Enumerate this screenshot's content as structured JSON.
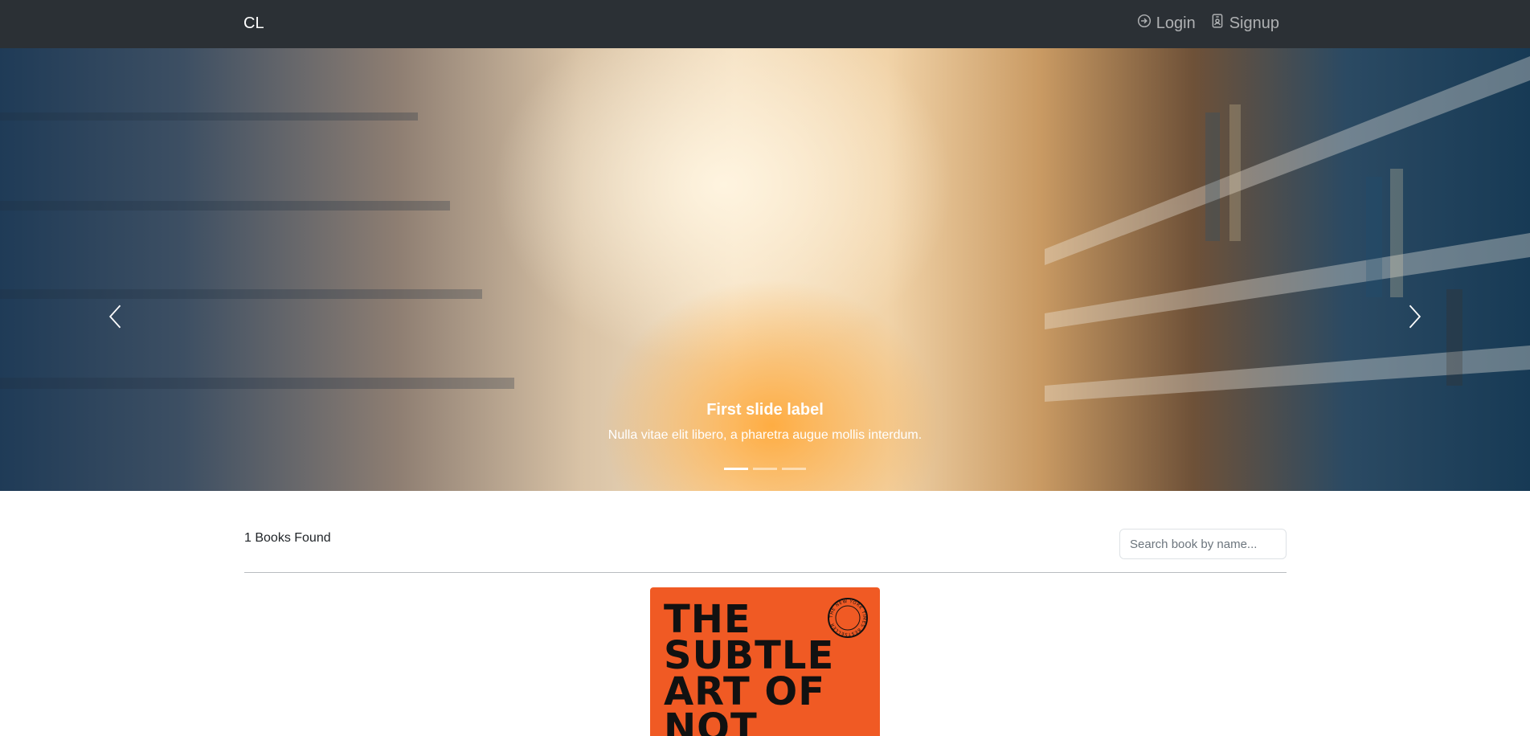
{
  "navbar": {
    "brand": "CL",
    "links": [
      {
        "label": "Login",
        "icon": "login-icon"
      },
      {
        "label": "Signup",
        "icon": "person-badge-icon"
      }
    ]
  },
  "hero": {
    "caption_title": "First slide label",
    "caption_text": "Nulla vitae elit libero, a pharetra augue mollis interdum.",
    "slide_count": 3,
    "active_slide": 1,
    "controls": {
      "prev_icon": "chevron-left-icon",
      "next_icon": "chevron-right-icon"
    }
  },
  "results": {
    "count_text": "1 Books Found",
    "search_placeholder": "Search book by name..."
  },
  "books": [
    {
      "cover_title": "THE\nSUBTLE\nART OF\nNOT",
      "cover_color": "#f05a24",
      "seal_text": "THE NEW YORK TIMES BESTSELLER"
    }
  ],
  "colors": {
    "navbar_bg": "#2b3035",
    "accent_book": "#f05a24"
  }
}
